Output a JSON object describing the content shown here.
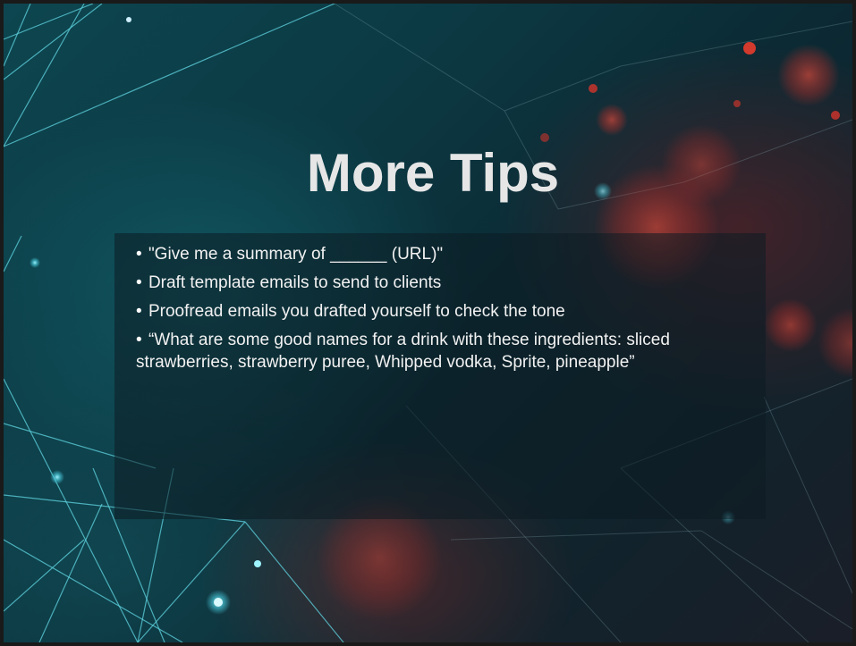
{
  "slide": {
    "title": "More Tips",
    "bullets": [
      "\"Give me a summary of ______ (URL)\"",
      "Draft template emails to send to clients",
      "Proofread emails you drafted yourself to check the tone",
      "“What are some good names for a drink with these ingredients: sliced strawberries, strawberry puree, Whipped vodka, Sprite, pineapple”"
    ],
    "bullet_symbol": "•"
  },
  "colors": {
    "title": "#e6e6e6",
    "body_text": "#f2f2f2",
    "background_teal": "#0d4650",
    "background_dark": "#11232c",
    "accent_red": "#c8342c",
    "line_cyan": "#5fd4e0"
  }
}
